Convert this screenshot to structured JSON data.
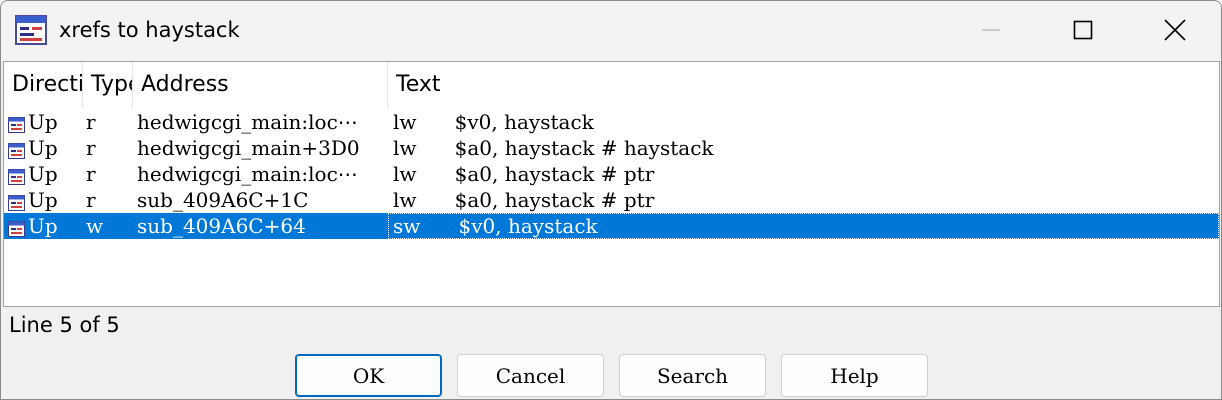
{
  "window": {
    "title": "xrefs to haystack"
  },
  "columns": [
    "Direction",
    "Type",
    "Address",
    "Text"
  ],
  "rows": [
    {
      "direction": "Up",
      "type": "r",
      "address": "hedwigcgi_main:loc⋯",
      "text": "lw      $v0, haystack"
    },
    {
      "direction": "Up",
      "type": "r",
      "address": "hedwigcgi_main+3D0",
      "text": "lw      $a0, haystack # haystack"
    },
    {
      "direction": "Up",
      "type": "r",
      "address": "hedwigcgi_main:loc⋯",
      "text": "lw      $a0, haystack # ptr"
    },
    {
      "direction": "Up",
      "type": "r",
      "address": "sub_409A6C+1C",
      "text": "lw      $a0, haystack # ptr"
    },
    {
      "direction": "Up",
      "type": "w",
      "address": "sub_409A6C+64",
      "text": "sw      $v0, haystack"
    }
  ],
  "selected_row": 4,
  "status": "Line 5 of 5",
  "buttons": {
    "ok": "OK",
    "cancel": "Cancel",
    "search": "Search",
    "help": "Help"
  },
  "colors": {
    "selection": "#0078d7"
  }
}
